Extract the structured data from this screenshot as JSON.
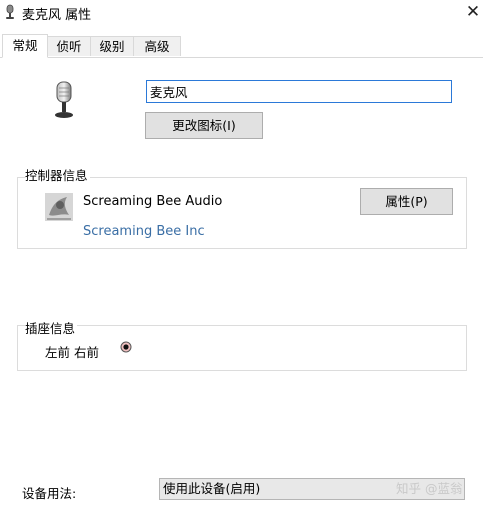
{
  "window": {
    "title": "麦克风 属性",
    "title_icon": "microphone-icon",
    "close_glyph": "✕"
  },
  "tabs": [
    {
      "label": "常规",
      "active": true
    },
    {
      "label": "侦听",
      "active": false
    },
    {
      "label": "级别",
      "active": false
    },
    {
      "label": "高级",
      "active": false
    }
  ],
  "device": {
    "icon": "microphone-icon",
    "name_value": "麦克风",
    "change_icon_label": "更改图标(I)"
  },
  "controller": {
    "group_label": "控制器信息",
    "icon": "controller-image-icon",
    "name": "Screaming Bee Audio",
    "vendor": "Screaming Bee Inc",
    "properties_label": "属性(P)"
  },
  "jack": {
    "group_label": "插座信息",
    "text": "左前 右前",
    "dot_icon": "jack-dot-icon"
  },
  "usage": {
    "label": "设备用法:",
    "selected": "使用此设备(启用)"
  },
  "watermark": "知乎 @蓝翁",
  "colors": {
    "accent": "#2b79d8",
    "link": "#3a6ea5",
    "button_bg": "#e1e1e1"
  }
}
